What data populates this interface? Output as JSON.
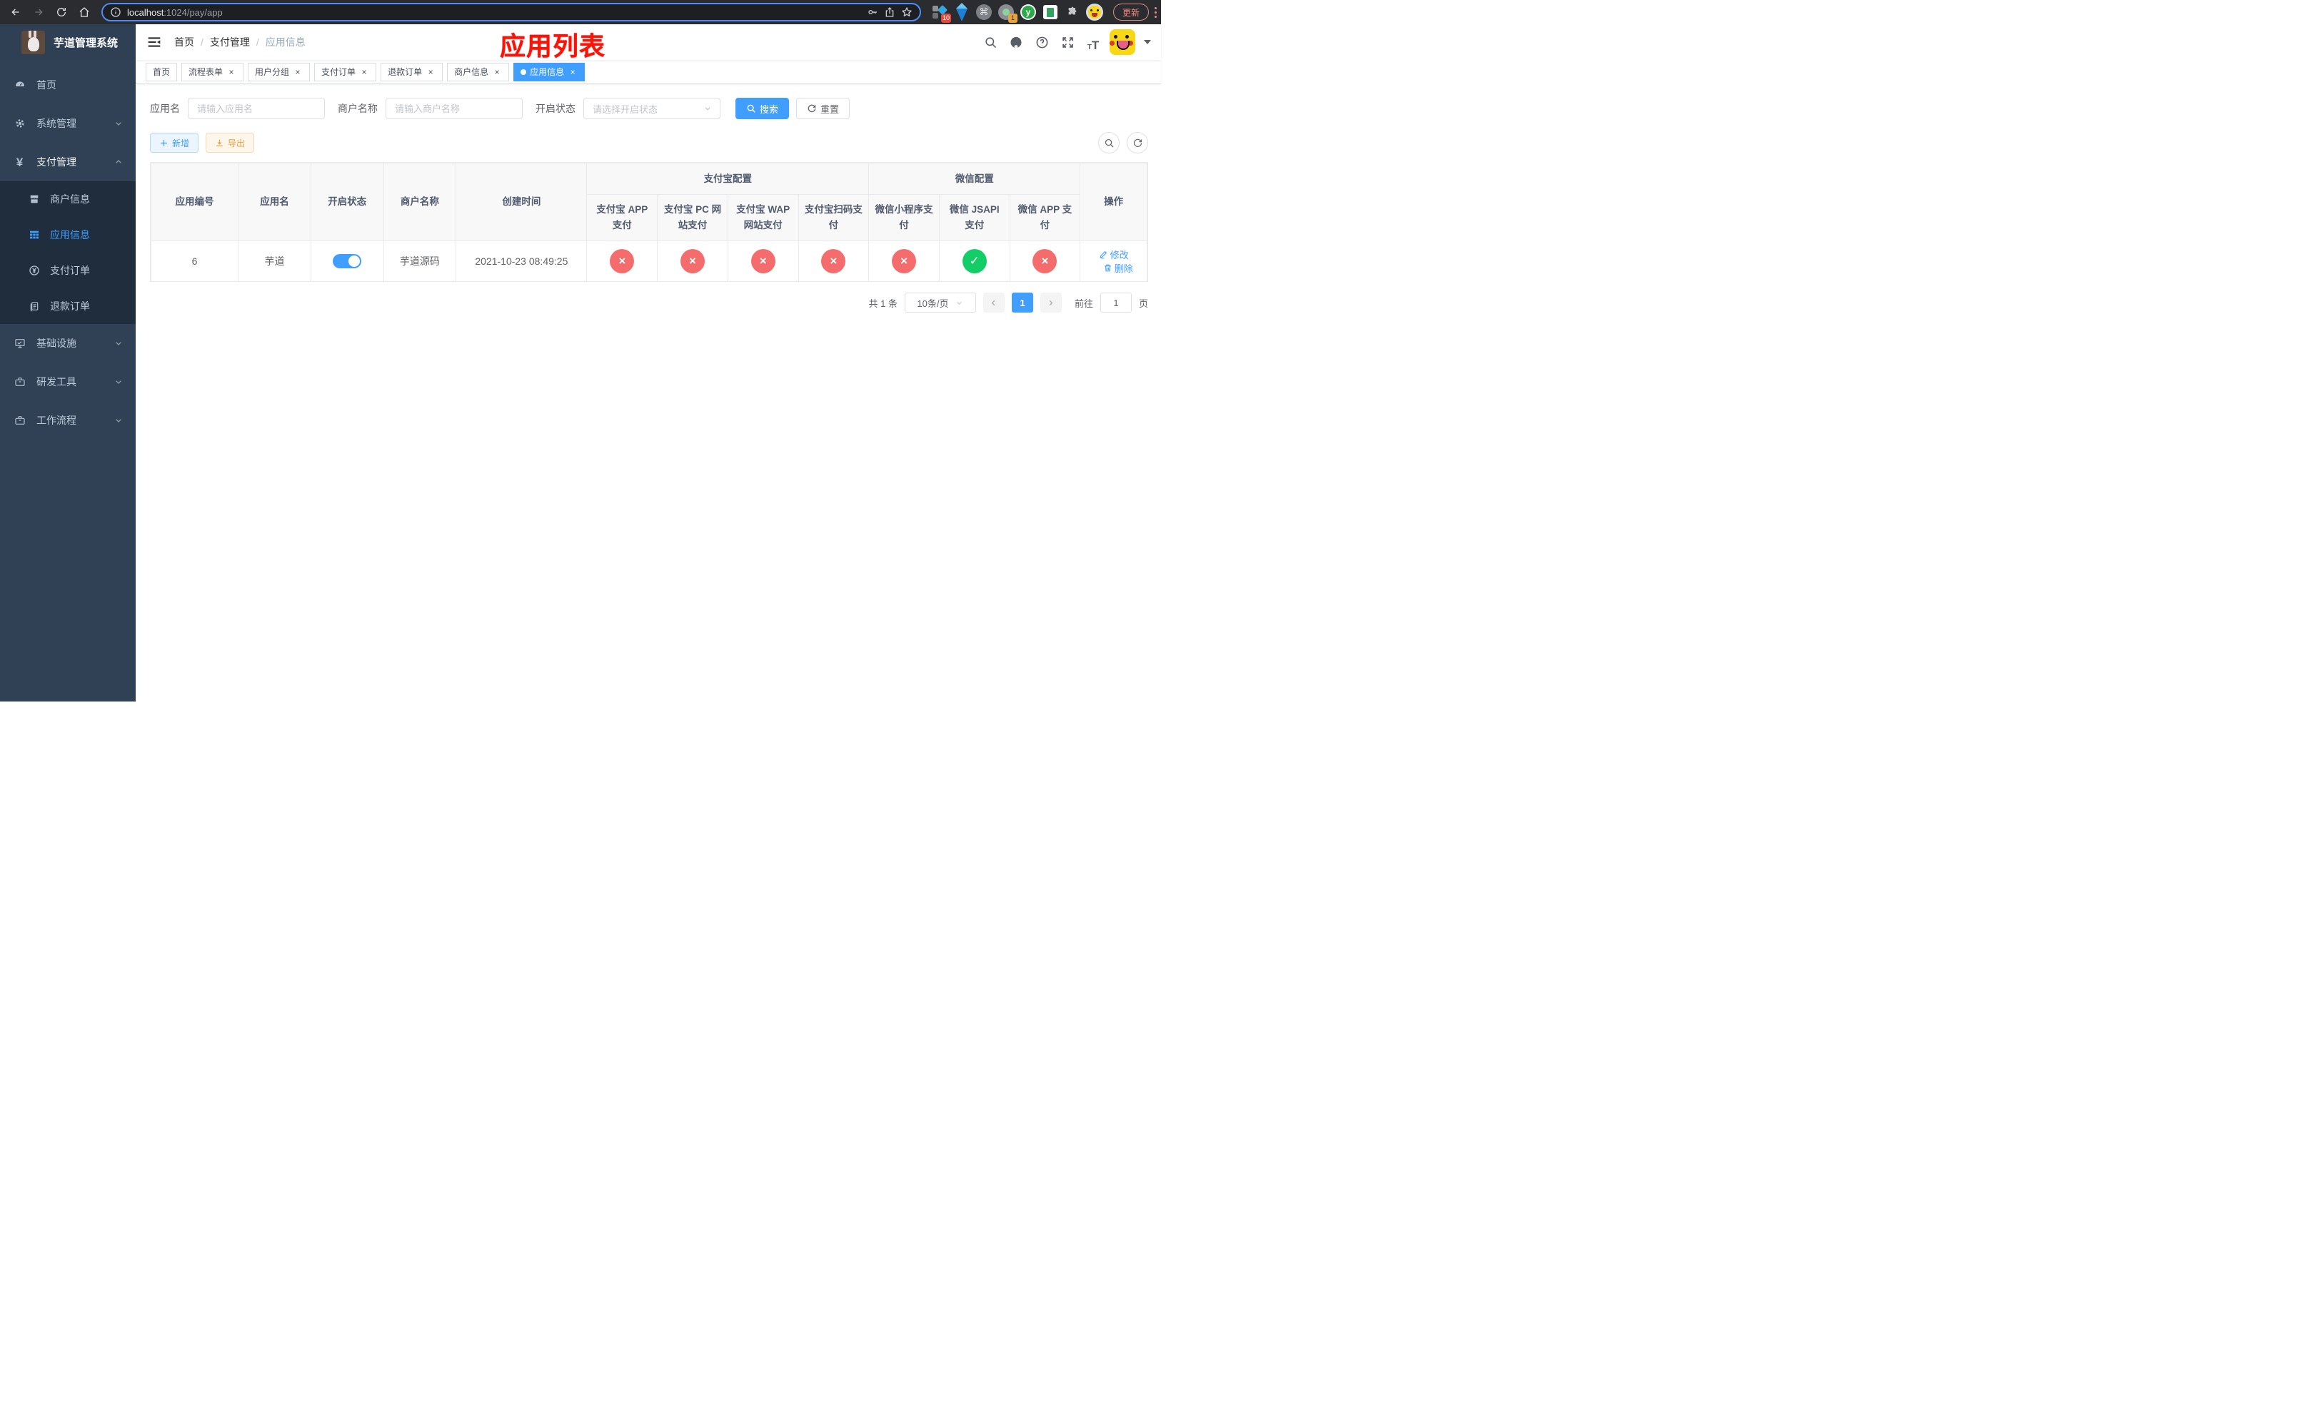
{
  "browser": {
    "url_host": "localhost",
    "url_rest": ":1024/pay/app",
    "ext_badge_1": "10",
    "ext_badge_2": "1",
    "ext_y_label": "y",
    "cmd_glyph": "⌘",
    "update_label": "更新"
  },
  "sidebar": {
    "logo_title": "芋道管理系统",
    "items": [
      {
        "label": "首页"
      },
      {
        "label": "系统管理"
      },
      {
        "label": "支付管理"
      },
      {
        "label": "商户信息"
      },
      {
        "label": "应用信息"
      },
      {
        "label": "支付订单"
      },
      {
        "label": "退款订单"
      },
      {
        "label": "基础设施"
      },
      {
        "label": "研发工具"
      },
      {
        "label": "工作流程"
      }
    ]
  },
  "navbar": {
    "breadcrumb": [
      "首页",
      "支付管理",
      "应用信息"
    ],
    "separator": "/",
    "annotation": "应用列表"
  },
  "tabs": [
    {
      "label": "首页"
    },
    {
      "label": "流程表单"
    },
    {
      "label": "用户分组"
    },
    {
      "label": "支付订单"
    },
    {
      "label": "退款订单"
    },
    {
      "label": "商户信息"
    },
    {
      "label": "应用信息"
    }
  ],
  "filters": {
    "app_name_label": "应用名",
    "app_name_placeholder": "请输入应用名",
    "merchant_label": "商户名称",
    "merchant_placeholder": "请输入商户名称",
    "status_label": "开启状态",
    "status_placeholder": "请选择开启状态",
    "search_label": "搜索",
    "reset_label": "重置"
  },
  "toolbar": {
    "add_label": "新增",
    "export_label": "导出"
  },
  "table": {
    "group_headers": {
      "alipay": "支付宝配置",
      "wechat": "微信配置"
    },
    "columns": [
      "应用编号",
      "应用名",
      "开启状态",
      "商户名称",
      "创建时间"
    ],
    "pay_columns": [
      "支付宝 APP 支付",
      "支付宝 PC 网站支付",
      "支付宝 WAP 网站支付",
      "支付宝扫码支付",
      "微信小程序支付",
      "微信 JSAPI 支付",
      "微信 APP 支付"
    ],
    "ops_header": "操作",
    "rows": [
      {
        "id": "6",
        "name": "芋道",
        "enabled": true,
        "merchant": "芋道源码",
        "created": "2021-10-23 08:49:25",
        "pay_status": [
          "no",
          "no",
          "no",
          "no",
          "no",
          "yes",
          "no"
        ],
        "edit_label": "修改",
        "delete_label": "删除"
      }
    ]
  },
  "pagination": {
    "total_label": "共 1 条",
    "page_size": "10条/页",
    "current_page": "1",
    "goto_label": "前往",
    "goto_value": "1",
    "page_suffix": "页"
  },
  "icons": {
    "close_glyph": "×",
    "check_glyph": "✓",
    "cross_glyph": "×",
    "yen_glyph": "¥"
  },
  "colors": {
    "primary": "#409eff",
    "danger": "#f56c6c",
    "success": "#13ce66",
    "sidebar_bg": "#304156",
    "submenu_bg": "#1f2d3d",
    "annotation_red": "#fd1205"
  }
}
